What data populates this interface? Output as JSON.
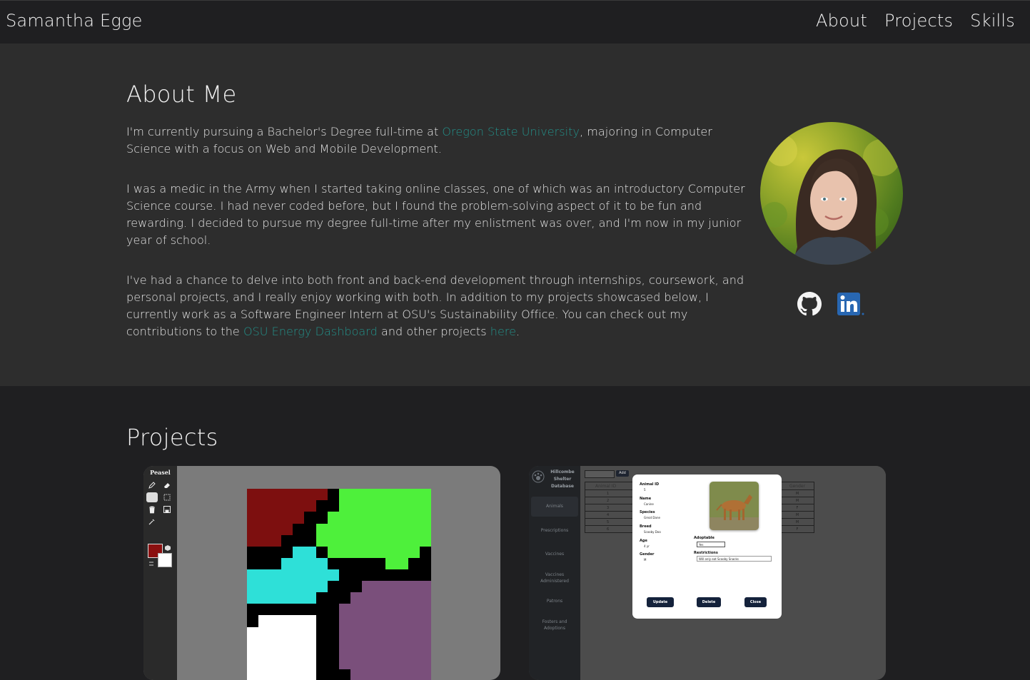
{
  "nav": {
    "brand": "Samantha Egge",
    "links": [
      "About",
      "Projects",
      "Skills"
    ]
  },
  "about": {
    "title": "About Me",
    "p1_a": "I'm currently pursuing a Bachelor's Degree full-time at ",
    "p1_link": "Oregon State University",
    "p1_b": ", majoring in Computer Science with a focus on Web and Mobile Development.",
    "p2": "I was a medic in the Army when I started taking online classes, one of which was an introductory Computer Science course. I had never coded before, but I found the problem-solving aspect of it to be fun and rewarding. I decided to pursue my degree full-time after my enlistment was over, and I'm now in my junior year of school.",
    "p3_a": "I've had a chance to delve into both front and back-end development through internships, coursework, and personal projects, and I really enjoy working with both. In addition to my projects showcased below, I currently work as a Software Engineer Intern at OSU's Sustainability Office. You can check out my contributions to the ",
    "p3_link1": "OSU Energy Dashboard",
    "p3_b": " and other projects ",
    "p3_link2": "here",
    "p3_c": ".",
    "social": [
      "github-icon",
      "linkedin-icon"
    ]
  },
  "projects": {
    "title": "Projects",
    "peasel": {
      "app_name": "Peasel"
    },
    "shelter": {
      "app_title": [
        "Hillcombe",
        "Shelter",
        "Database"
      ],
      "add_label": "Add",
      "nav": [
        "Animals",
        "Prescriptions",
        "Vaccines",
        "Vaccines Administered",
        "Patrons",
        "Fosters and Adoptions"
      ],
      "columns": [
        "Animal ID",
        "Gender"
      ],
      "ids": [
        "1",
        "2",
        "3",
        "4",
        "5",
        "6"
      ],
      "genders": [
        "M",
        "M",
        "F",
        "M",
        "M",
        "F"
      ],
      "modal": {
        "animal_id_label": "Animal ID",
        "animal_id": "5",
        "name_label": "Name",
        "name": "Canine",
        "species_label": "Species",
        "species": "Great Dane",
        "breed_label": "Breed",
        "breed": "Scooby Doo",
        "age_label": "Age",
        "age": "4 yr",
        "gender_label": "Gender",
        "gender": "M",
        "adoptable_label": "Adoptable",
        "adoptable": "Yes",
        "restrictions_label": "Restrictions",
        "restrictions": "Will only eat Scooby Snacks",
        "update": "Update",
        "delete": "Delete",
        "close": "Close"
      }
    }
  },
  "colors": {
    "accent_link": "#23918a",
    "nav_bg": "#1f1f21",
    "about_bg": "#2d2d2d",
    "linkedin": "#2867b2"
  }
}
